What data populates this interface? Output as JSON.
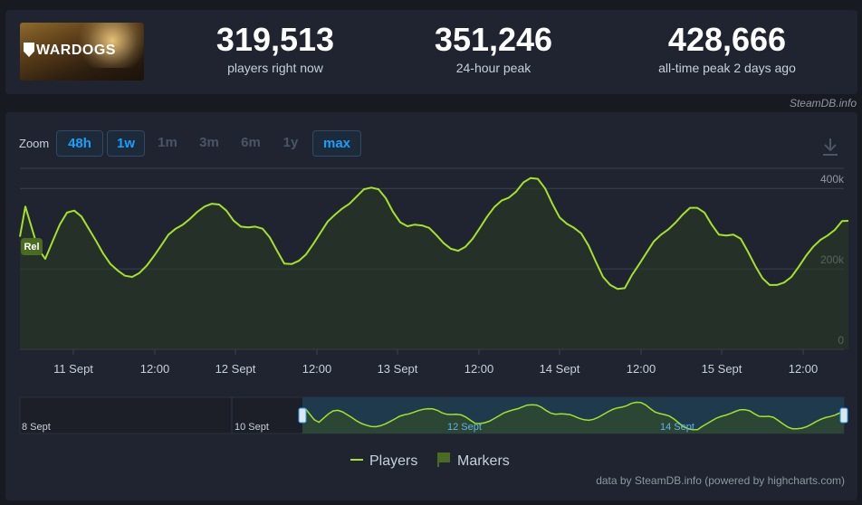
{
  "header": {
    "game_logo_text": "WARDOGS",
    "stats": [
      {
        "value": "319,513",
        "label": "players right now"
      },
      {
        "value": "351,246",
        "label": "24-hour peak"
      },
      {
        "value": "428,666",
        "label": "all-time peak 2 days ago"
      }
    ],
    "brand": "SteamDB.info"
  },
  "zoom": {
    "label": "Zoom",
    "buttons": [
      {
        "label": "48h",
        "active": true
      },
      {
        "label": "1w",
        "active": true
      },
      {
        "label": "1m",
        "active": false
      },
      {
        "label": "3m",
        "active": false
      },
      {
        "label": "6m",
        "active": false
      },
      {
        "label": "1y",
        "active": false
      },
      {
        "label": "max",
        "active": true
      }
    ]
  },
  "legend": [
    {
      "name": "Players",
      "color": "#a4e12b"
    },
    {
      "name": "Markers",
      "color": "#4c6b22"
    }
  ],
  "credit": "data by SteamDB.info (powered by highcharts.com)",
  "chart_data": {
    "type": "line",
    "colors": {
      "line": "#a4e12b",
      "area": "#2a3a25",
      "grid": "#3a4150",
      "navigator_bg": "#1f3a4d"
    },
    "ylim": [
      0,
      450000
    ],
    "y_ticks": [
      {
        "label": "0",
        "value": 0
      },
      {
        "label": "200k",
        "value": 200000
      },
      {
        "label": "400k",
        "value": 400000
      }
    ],
    "x_ticks": [
      "11 Sept",
      "12:00",
      "12 Sept",
      "12:00",
      "13 Sept",
      "12:00",
      "14 Sept",
      "12:00",
      "15 Sept",
      "12:00"
    ],
    "marker_label": "Rel",
    "series": [
      {
        "name": "Players",
        "points": [
          [
            0,
            280000
          ],
          [
            6,
            355000
          ],
          [
            14,
            295000
          ],
          [
            20,
            250000
          ],
          [
            28,
            225000
          ],
          [
            36,
            268000
          ],
          [
            44,
            310000
          ],
          [
            52,
            340000
          ],
          [
            60,
            345000
          ],
          [
            68,
            330000
          ],
          [
            76,
            300000
          ],
          [
            84,
            270000
          ],
          [
            92,
            238000
          ],
          [
            100,
            212000
          ],
          [
            108,
            196000
          ],
          [
            116,
            183000
          ],
          [
            124,
            180000
          ],
          [
            132,
            190000
          ],
          [
            140,
            208000
          ],
          [
            148,
            232000
          ],
          [
            156,
            258000
          ],
          [
            164,
            285000
          ],
          [
            172,
            300000
          ],
          [
            180,
            310000
          ],
          [
            188,
            325000
          ],
          [
            196,
            342000
          ],
          [
            204,
            355000
          ],
          [
            212,
            362000
          ],
          [
            220,
            360000
          ],
          [
            228,
            345000
          ],
          [
            236,
            320000
          ],
          [
            244,
            305000
          ],
          [
            252,
            303000
          ],
          [
            260,
            305000
          ],
          [
            268,
            300000
          ],
          [
            276,
            278000
          ],
          [
            284,
            245000
          ],
          [
            292,
            213000
          ],
          [
            300,
            212000
          ],
          [
            308,
            220000
          ],
          [
            316,
            236000
          ],
          [
            324,
            262000
          ],
          [
            332,
            290000
          ],
          [
            340,
            318000
          ],
          [
            348,
            335000
          ],
          [
            356,
            350000
          ],
          [
            364,
            362000
          ],
          [
            372,
            380000
          ],
          [
            380,
            398000
          ],
          [
            388,
            402000
          ],
          [
            396,
            398000
          ],
          [
            404,
            376000
          ],
          [
            412,
            342000
          ],
          [
            420,
            316000
          ],
          [
            428,
            306000
          ],
          [
            436,
            310000
          ],
          [
            444,
            308000
          ],
          [
            452,
            302000
          ],
          [
            460,
            284000
          ],
          [
            468,
            264000
          ],
          [
            476,
            250000
          ],
          [
            484,
            245000
          ],
          [
            492,
            255000
          ],
          [
            500,
            275000
          ],
          [
            508,
            302000
          ],
          [
            516,
            330000
          ],
          [
            524,
            354000
          ],
          [
            532,
            370000
          ],
          [
            540,
            377000
          ],
          [
            548,
            392000
          ],
          [
            556,
            415000
          ],
          [
            564,
            426000
          ],
          [
            572,
            424000
          ],
          [
            580,
            400000
          ],
          [
            588,
            362000
          ],
          [
            596,
            328000
          ],
          [
            604,
            312000
          ],
          [
            612,
            302000
          ],
          [
            620,
            288000
          ],
          [
            628,
            258000
          ],
          [
            636,
            218000
          ],
          [
            644,
            180000
          ],
          [
            652,
            160000
          ],
          [
            660,
            150000
          ],
          [
            668,
            152000
          ],
          [
            676,
            185000
          ],
          [
            684,
            212000
          ],
          [
            692,
            240000
          ],
          [
            700,
            268000
          ],
          [
            708,
            285000
          ],
          [
            716,
            298000
          ],
          [
            724,
            315000
          ],
          [
            732,
            335000
          ],
          [
            740,
            352000
          ],
          [
            748,
            352000
          ],
          [
            756,
            340000
          ],
          [
            764,
            310000
          ],
          [
            772,
            285000
          ],
          [
            780,
            283000
          ],
          [
            788,
            285000
          ],
          [
            796,
            275000
          ],
          [
            804,
            243000
          ],
          [
            812,
            208000
          ],
          [
            820,
            177000
          ],
          [
            828,
            160000
          ],
          [
            836,
            160000
          ],
          [
            844,
            166000
          ],
          [
            852,
            180000
          ],
          [
            860,
            205000
          ],
          [
            868,
            232000
          ],
          [
            876,
            255000
          ],
          [
            884,
            272000
          ],
          [
            892,
            283000
          ],
          [
            900,
            297000
          ],
          [
            908,
            319000
          ],
          [
            915,
            319513
          ]
        ]
      }
    ],
    "navigator": {
      "labels": [
        "8 Sept",
        "10 Sept",
        "12 Sept",
        "14 Sept"
      ],
      "selected_from": "10 Sept",
      "selected_to": "15 Sept"
    }
  }
}
